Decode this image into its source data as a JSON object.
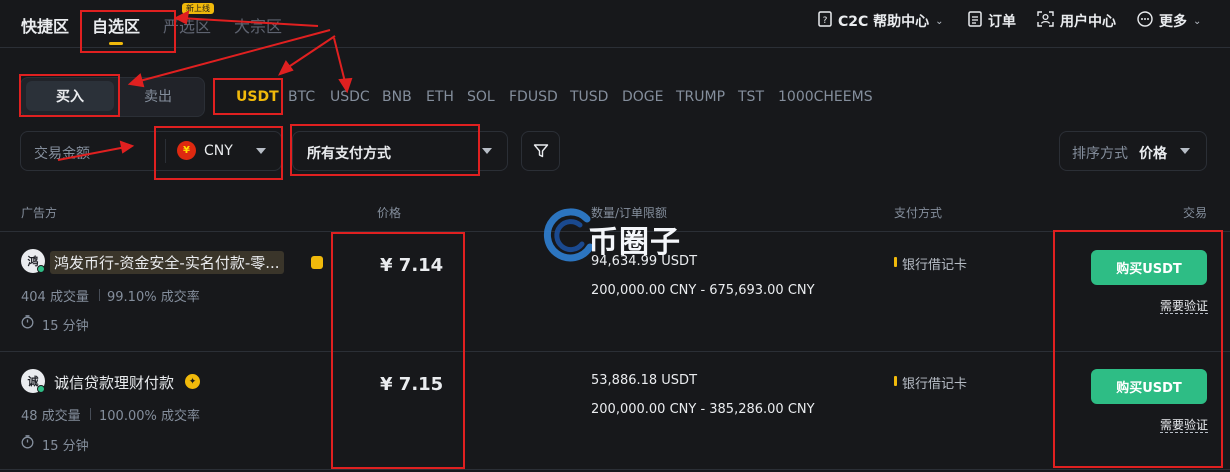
{
  "nav": {
    "tabs": [
      {
        "label": "快捷区"
      },
      {
        "label": "自选区"
      },
      {
        "label": "严选区",
        "badge": "新上线"
      },
      {
        "label": "大宗区"
      }
    ],
    "right": [
      {
        "icon": "help-doc-icon",
        "label": "C2C 帮助中心"
      },
      {
        "icon": "order-list-icon",
        "label": "订单"
      },
      {
        "icon": "user-center-icon",
        "label": "用户中心"
      },
      {
        "icon": "more-dots-icon",
        "label": "更多"
      }
    ]
  },
  "trade_side": {
    "buy": "买入",
    "sell": "卖出"
  },
  "coins": [
    "USDT",
    "BTC",
    "USDC",
    "BNB",
    "ETH",
    "SOL",
    "FDUSD",
    "TUSD",
    "DOGE",
    "TRUMP",
    "TST",
    "1000CHEEMS"
  ],
  "filters": {
    "amount_placeholder": "交易金额",
    "currency": "CNY",
    "currency_flag_glyph": "¥",
    "payment": "所有支付方式",
    "sort_label": "排序方式",
    "sort_value": "价格"
  },
  "table": {
    "headers": {
      "advertiser": "广告方",
      "price": "价格",
      "limit": "数量/订单限额",
      "payment": "支付方式",
      "trade": "交易"
    },
    "rows": [
      {
        "avatar": "鸿",
        "name": "鸿发币行-资金安全-实名付款-零...",
        "trades": "404 成交量",
        "completion": "99.10% 成交率",
        "time": "15 分钟",
        "price": "¥ 7.14",
        "quantity": "94,634.99 USDT",
        "limit": "200,000.00 CNY - 675,693.00 CNY",
        "payment": "银行借记卡",
        "button": "购买USDT",
        "verify": "需要验证"
      },
      {
        "avatar": "诚",
        "name": "诚信贷款理财付款",
        "trades": "48 成交量",
        "completion": "100.00% 成交率",
        "time": "15 分钟",
        "price": "¥ 7.15",
        "quantity": "53,886.18 USDT",
        "limit": "200,000.00 CNY - 385,286.00 CNY",
        "payment": "银行借记卡",
        "button": "购买USDT",
        "verify": "需要验证"
      }
    ]
  },
  "watermark": {
    "text": "币圈子"
  },
  "colors": {
    "background": "#17181b",
    "accent": "#f0b90b",
    "buy_green": "#2ebd85",
    "annotation_red": "#e02020"
  }
}
